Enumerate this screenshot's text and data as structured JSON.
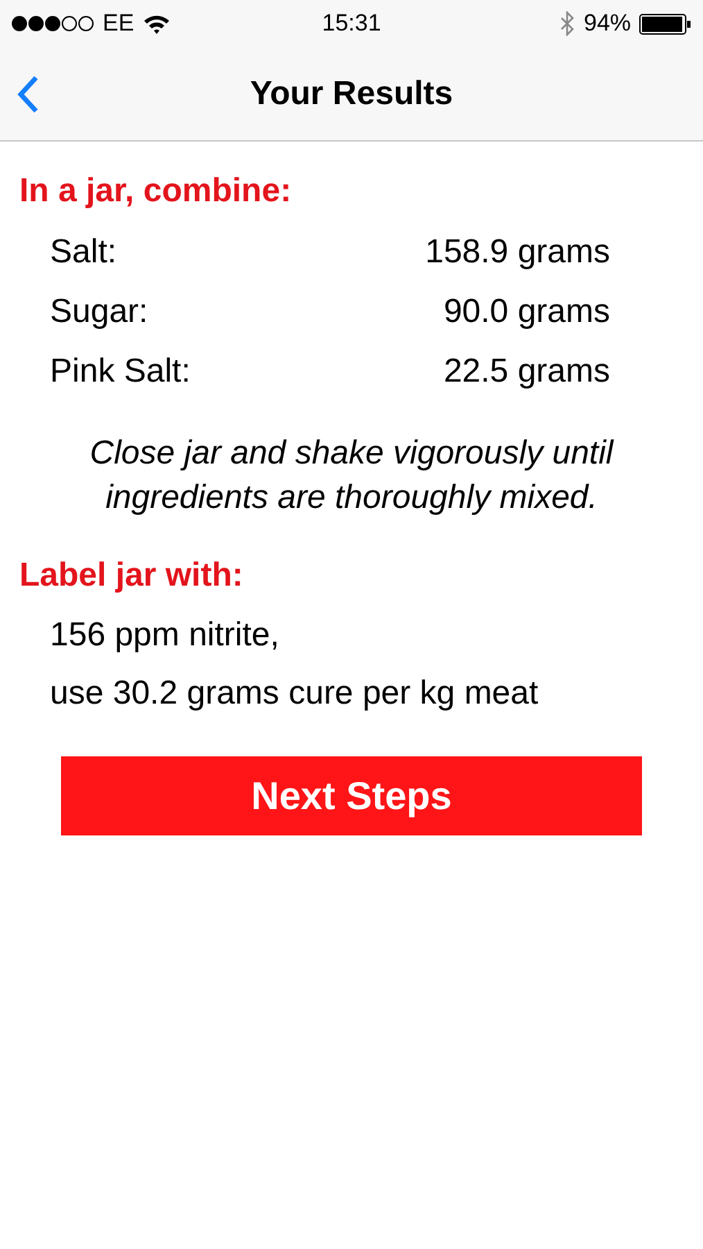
{
  "status_bar": {
    "carrier": "EE",
    "time": "15:31",
    "battery": "94%"
  },
  "nav": {
    "title": "Your Results"
  },
  "combine": {
    "heading": "In a jar, combine:",
    "rows": [
      {
        "name": "Salt:",
        "amount": "158.9 grams"
      },
      {
        "name": "Sugar:",
        "amount": "90.0 grams"
      },
      {
        "name": "Pink Salt:",
        "amount": "22.5 grams"
      }
    ],
    "instruction": "Close jar and shake vigorously until ingredients are thoroughly mixed."
  },
  "label": {
    "heading": "Label jar with:",
    "lines": [
      "156 ppm nitrite,",
      "use 30.2 grams cure per kg meat"
    ]
  },
  "button": "Next Steps"
}
